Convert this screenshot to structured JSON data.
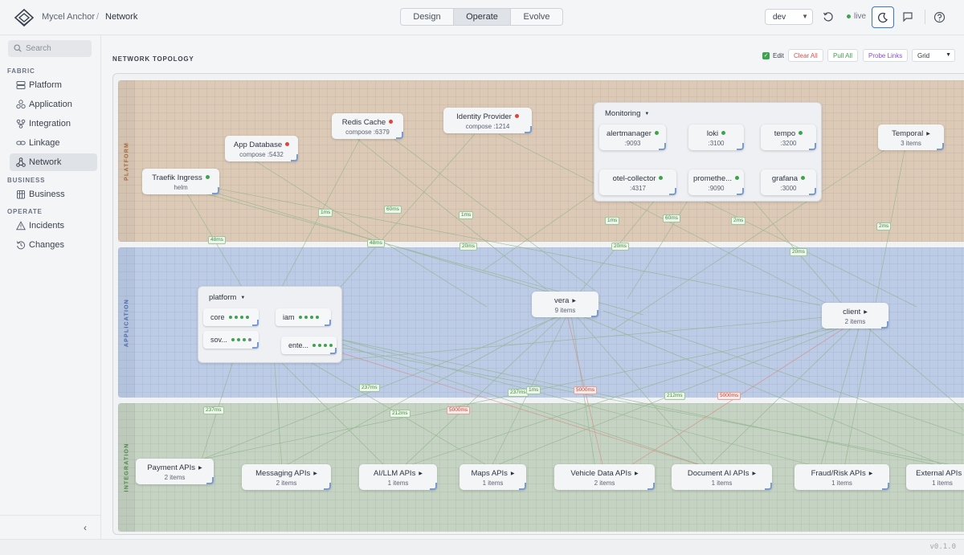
{
  "header": {
    "app_name": "Mycel Anchor",
    "separator": "/",
    "page": "Network",
    "modes": [
      "Design",
      "Operate",
      "Evolve"
    ],
    "active_mode": "Operate",
    "environment": "dev",
    "live_label": "live",
    "icons": [
      "refresh-icon",
      "moon-icon",
      "chat-icon",
      "help-icon"
    ]
  },
  "sidebar": {
    "search_placeholder": "Search",
    "sections": [
      {
        "label": "FABRIC",
        "items": [
          {
            "label": "Platform",
            "icon": "server-icon"
          },
          {
            "label": "Application",
            "icon": "cubes-icon"
          },
          {
            "label": "Integration",
            "icon": "integration-icon"
          },
          {
            "label": "Linkage",
            "icon": "link-icon"
          },
          {
            "label": "Network",
            "icon": "network-icon",
            "active": true
          }
        ]
      },
      {
        "label": "BUSINESS",
        "items": [
          {
            "label": "Business",
            "icon": "building-icon"
          }
        ]
      },
      {
        "label": "OPERATE",
        "items": [
          {
            "label": "Incidents",
            "icon": "warning-icon"
          },
          {
            "label": "Changes",
            "icon": "history-icon"
          }
        ]
      }
    ],
    "collapse_label": "‹"
  },
  "main": {
    "title": "NETWORK TOPOLOGY",
    "edit_label": "Edit",
    "edit_checked": true,
    "clear_all": "Clear All",
    "pull_all": "Pull All",
    "probe_links": "Probe Links",
    "layout": "Grid",
    "colors": {
      "ok": "#3fa34d",
      "error": "#e0443a",
      "accent": "#3f73c4"
    }
  },
  "lanes": [
    "PLATFORM",
    "APPLICATION",
    "INTEGRATION"
  ],
  "nodes": {
    "traefik": {
      "title": "Traefik Ingress",
      "sub": "helm",
      "status": "ok"
    },
    "appdb": {
      "title": "App Database",
      "sub": "compose :5432",
      "status": "error"
    },
    "redis": {
      "title": "Redis Cache",
      "sub": "compose :6379",
      "status": "error"
    },
    "idp": {
      "title": "Identity Provider",
      "sub": "compose :1214",
      "status": "error"
    },
    "temporal": {
      "title": "Temporal",
      "sub": "3 items"
    },
    "vera": {
      "title": "vera",
      "sub": "9 items"
    },
    "client": {
      "title": "client",
      "sub": "2 items"
    },
    "payment": {
      "title": "Payment APIs",
      "sub": "2 items"
    },
    "messaging": {
      "title": "Messaging APIs",
      "sub": "2 items"
    },
    "ai": {
      "title": "AI/LLM APIs",
      "sub": "1 items"
    },
    "maps": {
      "title": "Maps APIs",
      "sub": "1 items"
    },
    "vehicle": {
      "title": "Vehicle Data APIs",
      "sub": "2 items"
    },
    "docai": {
      "title": "Document AI APIs",
      "sub": "1 items"
    },
    "fraud": {
      "title": "Fraud/Risk APIs",
      "sub": "1 items"
    },
    "external": {
      "title": "External APIs",
      "sub": "1 items"
    }
  },
  "monitoring": {
    "title": "Monitoring",
    "items": {
      "alertmanager": {
        "title": "alertmanager",
        "sub": ":9093"
      },
      "loki": {
        "title": "loki",
        "sub": ":3100"
      },
      "tempo": {
        "title": "tempo",
        "sub": ":3200"
      },
      "otel": {
        "title": "otel-collector",
        "sub": ":4317"
      },
      "prometheus": {
        "title": "promethe...",
        "sub": ":9090"
      },
      "grafana": {
        "title": "grafana",
        "sub": ":3000"
      }
    }
  },
  "platform_group": {
    "title": "platform",
    "items": {
      "core": "core",
      "iam": "iam",
      "sov": "sov...",
      "ente": "ente..."
    }
  },
  "latencies": {
    "l1": "1ms",
    "l2": "60ms",
    "l3": "1ms",
    "l4": "48ms",
    "l5": "48ms",
    "l6": "20ms",
    "l7": "1ms",
    "l8": "60ms",
    "l9": "2ms",
    "l10": "20ms",
    "l11": "20ms",
    "l12": "2ms",
    "l13": "237ms",
    "l14": "237ms",
    "l15": "212ms",
    "l16": "5000ms",
    "l17": "237ms",
    "l18": "1ms",
    "l19": "5000ms",
    "l20": "212ms",
    "l21": "5000ms"
  },
  "footer": {
    "version": "v0.1.0"
  }
}
